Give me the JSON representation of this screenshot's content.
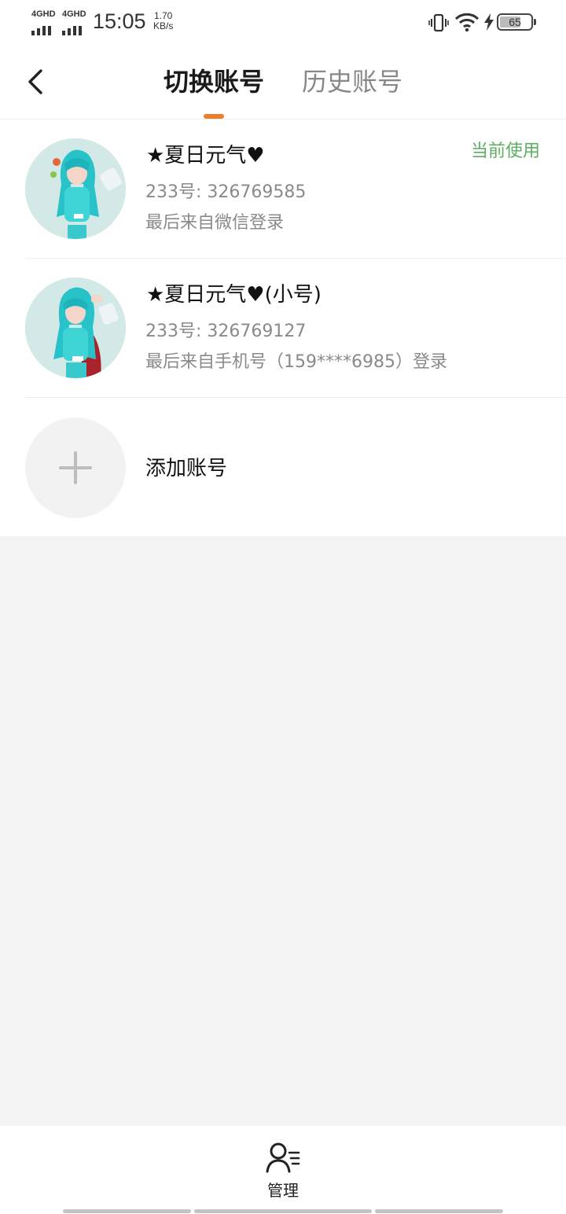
{
  "status_bar": {
    "network1": "4GHD",
    "network2": "4GHD",
    "time": "15:05",
    "speed_value": "1.70",
    "speed_unit": "KB/s",
    "battery": "65"
  },
  "header": {
    "tab_active": "切换账号",
    "tab_inactive": "历史账号",
    "accent_color": "#f07e28"
  },
  "accounts": [
    {
      "name": "★夏日元气♥",
      "id_text": "233号: 326769585",
      "login_text": "最后来自微信登录",
      "badge": "当前使用"
    },
    {
      "name": "★夏日元气♥(小号)",
      "id_text": "233号: 326769127",
      "login_text": "最后来自手机号（159****6985）登录"
    }
  ],
  "add_account": {
    "label": "添加账号",
    "icon": "plus-icon"
  },
  "bottom_nav": {
    "manage_label": "管理",
    "icon": "user-manage-icon"
  },
  "colors": {
    "badge_green": "#5cae62",
    "page_bg": "#f4f4f4"
  }
}
